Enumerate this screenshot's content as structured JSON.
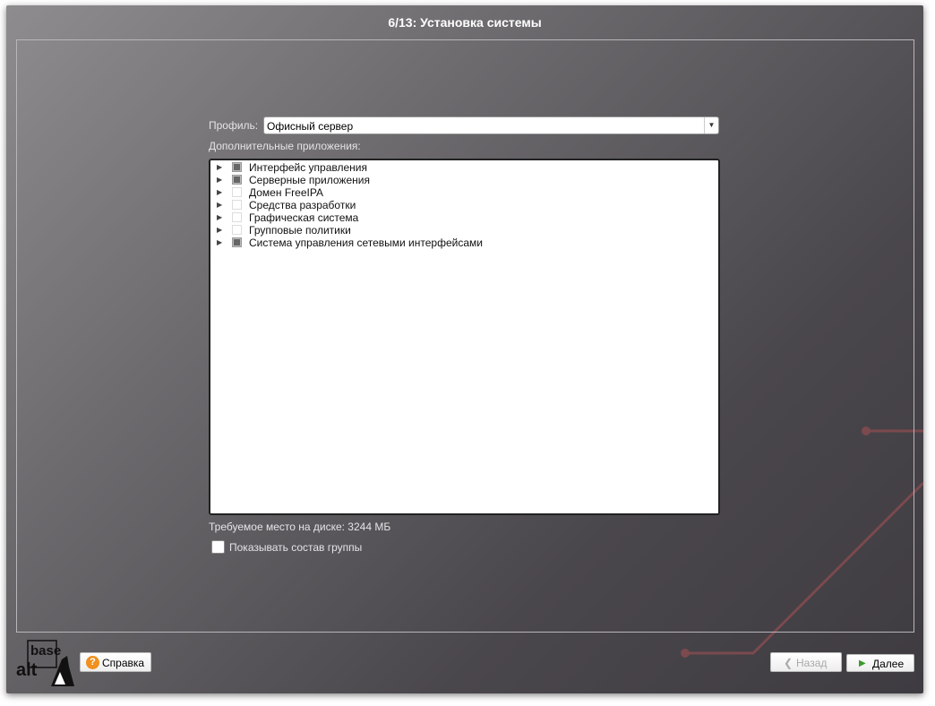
{
  "window": {
    "title": "6/13: Установка системы"
  },
  "profile": {
    "label": "Профиль:",
    "value": "Офисный сервер"
  },
  "apps": {
    "label": "Дополнительные приложения:",
    "items": [
      {
        "label": "Интерфейс управления",
        "checked": "partial"
      },
      {
        "label": "Серверные приложения",
        "checked": "partial"
      },
      {
        "label": "Домен FreeIPA",
        "checked": "no"
      },
      {
        "label": "Средства разработки",
        "checked": "no"
      },
      {
        "label": "Графическая система",
        "checked": "no"
      },
      {
        "label": "Групповые политики",
        "checked": "no"
      },
      {
        "label": "Система управления сетевыми интерфейсами",
        "checked": "partial"
      }
    ]
  },
  "disk": "Требуемое место на диске: 3244 МБ",
  "show_group": {
    "label": "Показывать состав группы",
    "checked": false
  },
  "buttons": {
    "help": "Справка",
    "back": "Назад",
    "next": "Далее"
  },
  "logo": {
    "text": "base alt"
  },
  "colors": {
    "accent_line": "#7a4a4e",
    "help_icon": "#f0901e",
    "next_arrow": "#3a9a2a"
  }
}
